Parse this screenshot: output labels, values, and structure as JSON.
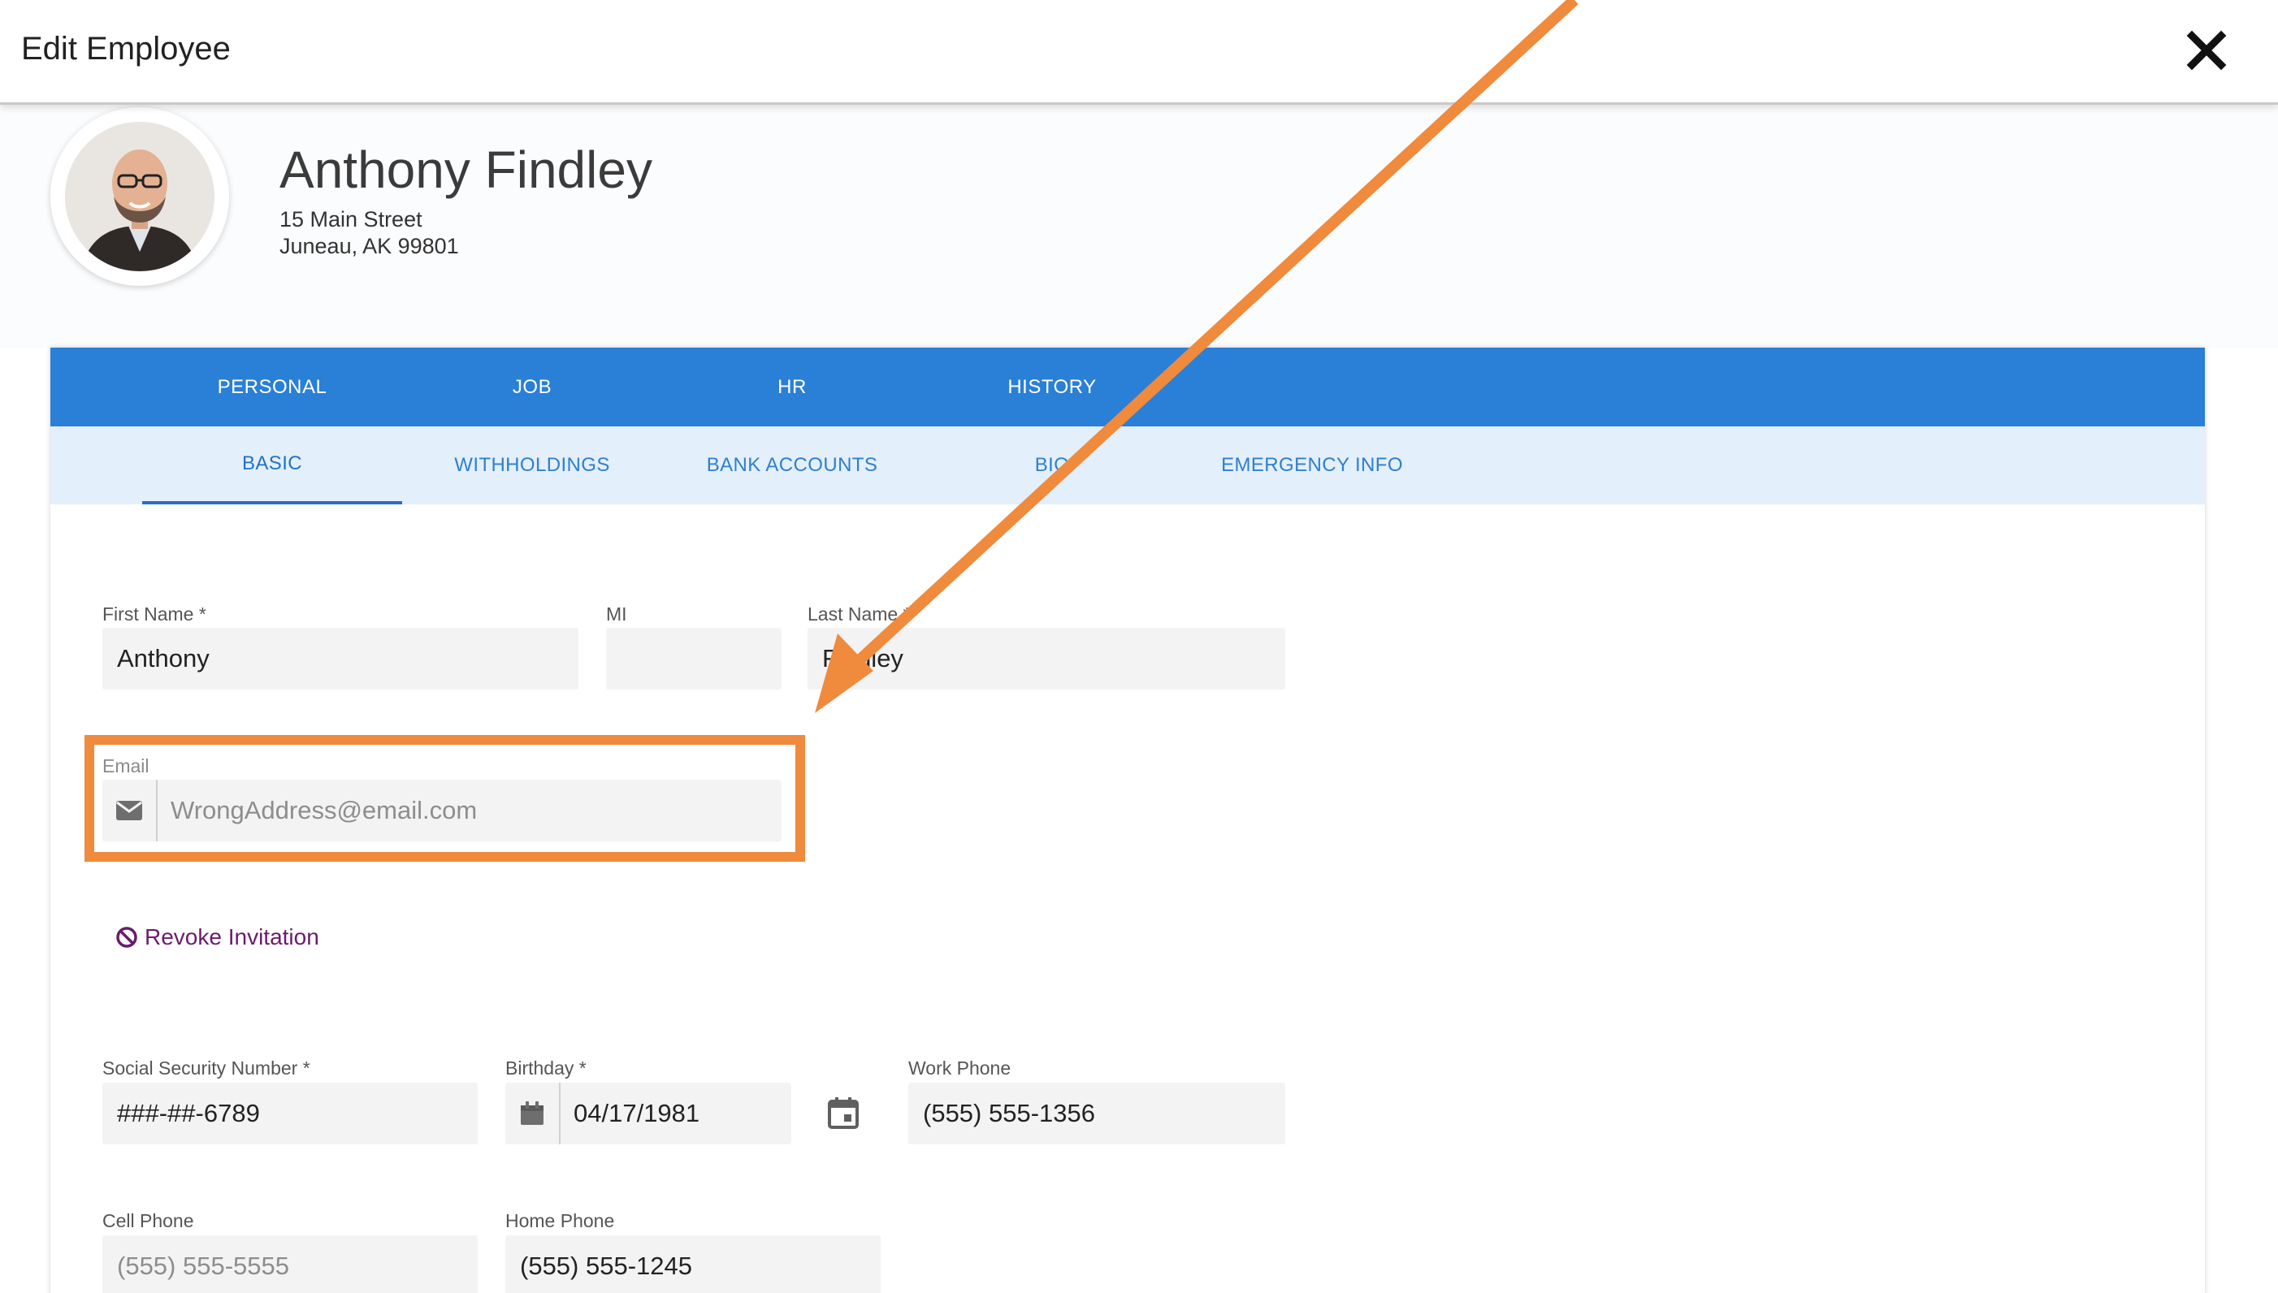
{
  "header": {
    "title": "Edit Employee",
    "close_icon": "close-icon"
  },
  "profile": {
    "name": "Anthony Findley",
    "address_line1": "15 Main Street",
    "address_line2": "Juneau, AK 99801",
    "avatar_icon": "avatar-photo"
  },
  "main_tabs": [
    {
      "label": "PERSONAL"
    },
    {
      "label": "JOB"
    },
    {
      "label": "HR"
    },
    {
      "label": "HISTORY"
    }
  ],
  "sub_tabs": [
    {
      "label": "BASIC",
      "active": true
    },
    {
      "label": "WITHHOLDINGS"
    },
    {
      "label": "BANK ACCOUNTS"
    },
    {
      "label": "BIO"
    },
    {
      "label": "EMERGENCY INFO"
    }
  ],
  "form": {
    "first_name": {
      "label": "First Name *",
      "value": "Anthony"
    },
    "mi": {
      "label": "MI",
      "value": ""
    },
    "last_name": {
      "label": "Last Name *",
      "value": "Findley"
    },
    "email": {
      "label": "Email",
      "value": "WrongAddress@email.com",
      "icon": "envelope-icon"
    },
    "revoke": {
      "label": "Revoke Invitation",
      "icon": "block-icon"
    },
    "ssn": {
      "label": "Social Security Number *",
      "value": "###-##-6789"
    },
    "birthday": {
      "label": "Birthday *",
      "value": "04/17/1981",
      "icon": "calendar-icon"
    },
    "work_phone": {
      "label": "Work Phone",
      "value": "(555) 555-1356"
    },
    "cell_phone": {
      "label": "Cell Phone",
      "placeholder": "(555) 555-5555"
    },
    "home_phone": {
      "label": "Home Phone",
      "value": "(555) 555-1245"
    }
  },
  "colors": {
    "primary_tab_bar": "#2a7fd6",
    "secondary_tab_bar": "#e3effb",
    "annotation": "#f08a3c",
    "revoke_link": "#6a1c6d"
  }
}
